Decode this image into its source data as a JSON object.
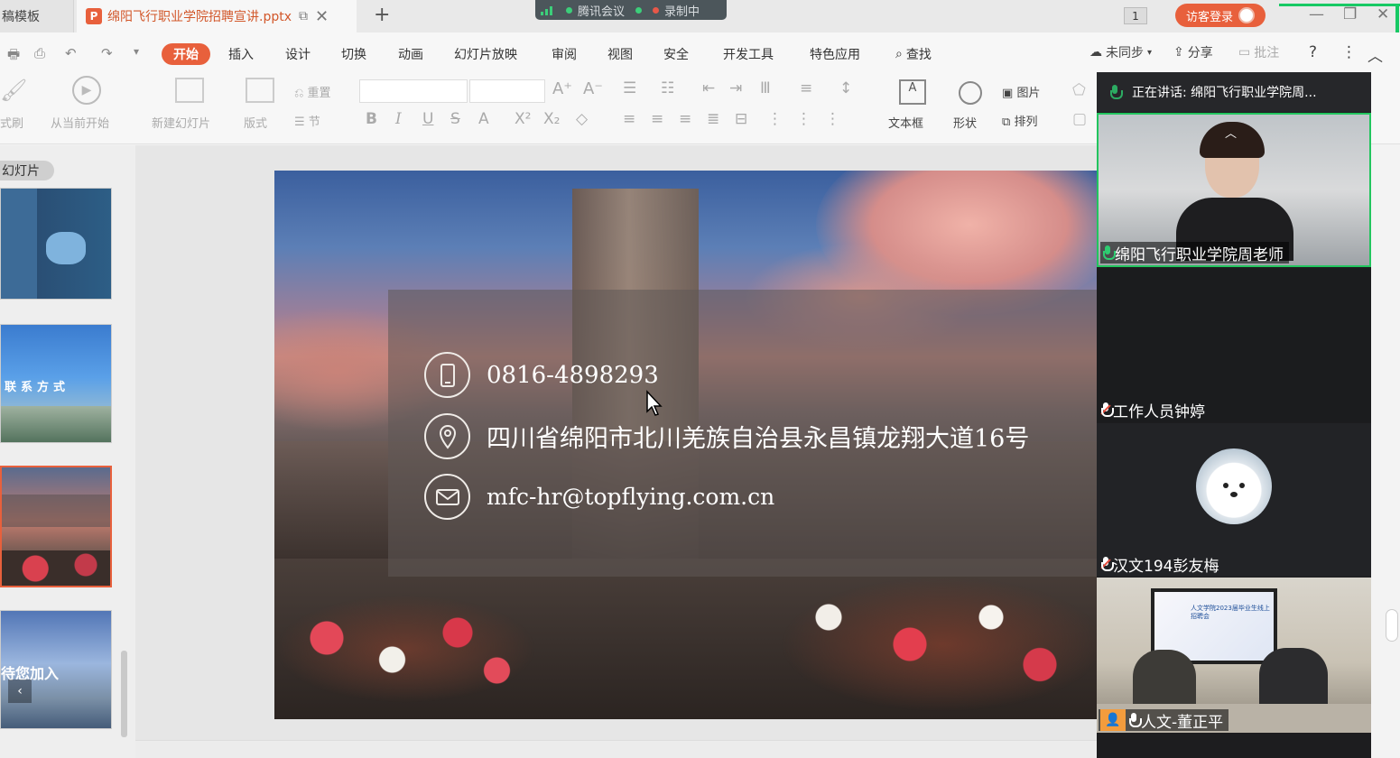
{
  "tabs": {
    "template_tab": "稿模板",
    "active_file": "绵阳飞行职业学院招聘宣讲.pptx",
    "file_icon_letter": "P"
  },
  "meeting_bar": {
    "app": "腾讯会议",
    "recording": "录制中"
  },
  "topright": {
    "badge": "1",
    "guest_login": "访客登录"
  },
  "menu": {
    "items": [
      "开始",
      "插入",
      "设计",
      "切换",
      "动画",
      "幻灯片放映",
      "审阅",
      "视图",
      "安全",
      "开发工具",
      "特色应用"
    ],
    "search": "查找",
    "sync": "未同步",
    "share": "分享",
    "comment": "批注"
  },
  "ribbon": {
    "format_brush": "式刷",
    "play_from_current": "从当前开始",
    "new_slide": "新建幻灯片",
    "layout": "版式",
    "reset": "重置",
    "section": "节",
    "textbox": "文本框",
    "shape": "形状",
    "picture": "图片",
    "arrange": "排列"
  },
  "left_panel": {
    "slides_tab": "幻灯片",
    "thumb2_text": "联系方式",
    "thumb4_text": "待您加入"
  },
  "slide": {
    "phone": "0816-4898293",
    "address": "四川省绵阳市北川羌族自治县永昌镇龙翔大道16号",
    "email": "mfc-hr@topflying.com.cn"
  },
  "meeting_panel": {
    "speaking": "正在讲话: 绵阳飞行职业学院周...",
    "participants": [
      {
        "name": "绵阳飞行职业学院周老师",
        "mic": "on"
      },
      {
        "name": "工作人员钟婷",
        "mic": "off"
      },
      {
        "name": "汉文194彭友梅",
        "mic": "off"
      },
      {
        "name": "人文-董正平",
        "mic": "on"
      }
    ],
    "screen_title": "人文学院2023届毕业生线上招聘会"
  },
  "colors": {
    "accent": "#e8603c",
    "meeting_green": "#22c55e"
  }
}
